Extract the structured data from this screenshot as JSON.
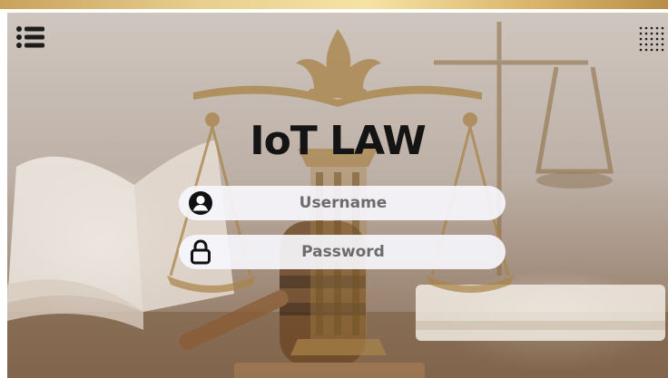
{
  "app": {
    "title": "IoT LAW",
    "accent_color": "#b08a4e"
  },
  "header": {
    "menu_icon": "list-menu-icon",
    "apps_icon": "dots-grid-icon"
  },
  "login": {
    "username": {
      "placeholder": "Username",
      "icon": "user-circle-icon"
    },
    "password": {
      "placeholder": "Password",
      "icon": "lock-icon"
    }
  }
}
